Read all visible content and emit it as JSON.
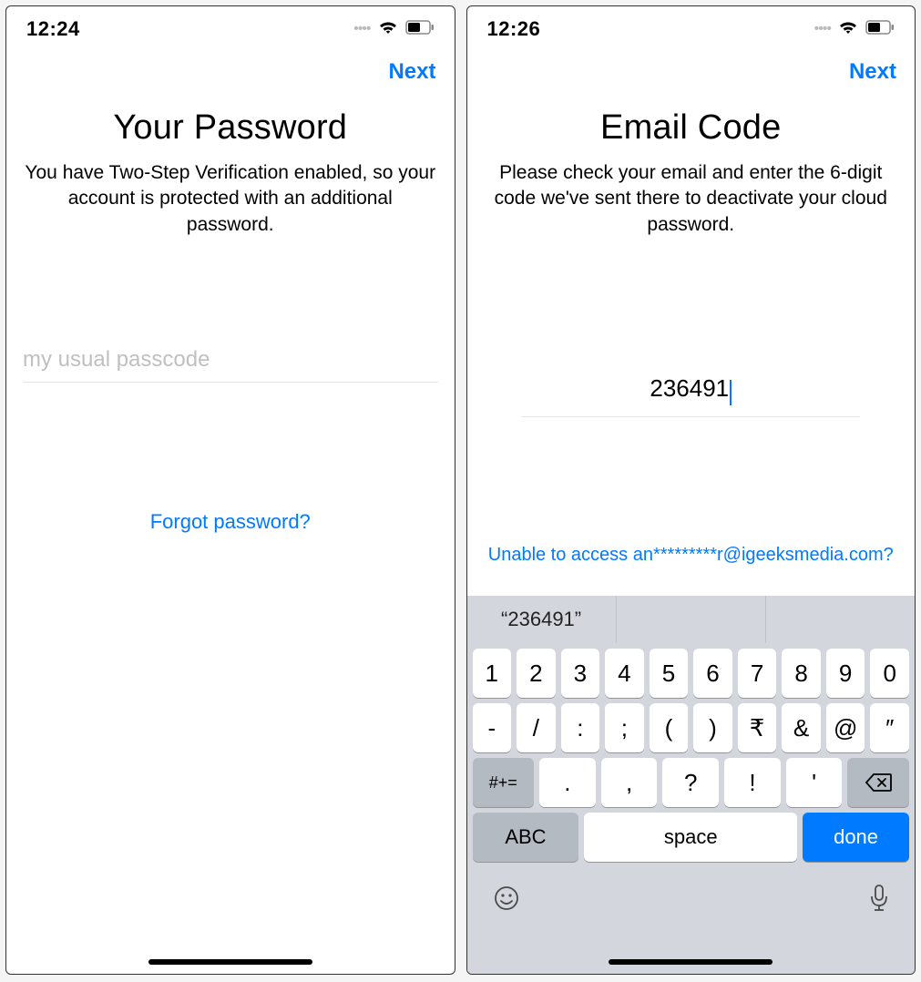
{
  "left": {
    "status_time": "12:24",
    "next_label": "Next",
    "title": "Your Password",
    "subtitle": "You have Two-Step Verification enabled, so your account is protected with an additional password.",
    "password_placeholder": "my usual passcode",
    "forgot_label": "Forgot password?"
  },
  "right": {
    "status_time": "12:26",
    "next_label": "Next",
    "title": "Email Code",
    "subtitle": "Please check your email and enter the 6-digit code we've sent there to deactivate your cloud password.",
    "code_value": "236491",
    "unable_label": "Unable to access an*********r@igeeksmedia.com?"
  },
  "keyboard": {
    "suggestion": "“236491”",
    "row1": [
      "1",
      "2",
      "3",
      "4",
      "5",
      "6",
      "7",
      "8",
      "9",
      "0"
    ],
    "row2": [
      "-",
      "/",
      ":",
      ";",
      "(",
      ")",
      "₹",
      "&",
      "@",
      "″"
    ],
    "shift": "#+=",
    "row3": [
      ".",
      ",",
      "?",
      "!",
      "'"
    ],
    "abc": "ABC",
    "space": "space",
    "done": "done"
  }
}
